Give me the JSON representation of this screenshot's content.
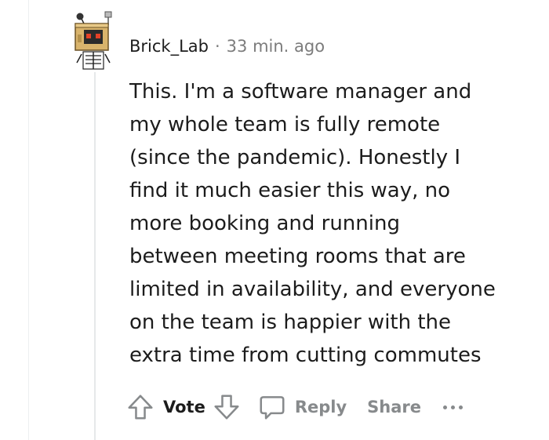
{
  "comment": {
    "username": "Brick_Lab",
    "separator": "·",
    "timestamp": "33 min. ago",
    "body": "This. I'm a software manager and\nmy whole team is fully remote\n(since the pandemic). Honestly I\nfind it much easier this way, no\nmore booking and running\nbetween meeting rooms that are\nlimited in availability, and everyone\non the team is happier with the\nextra time from cutting commutes"
  },
  "actions": {
    "vote_label": "Vote",
    "reply_label": "Reply",
    "share_label": "Share"
  },
  "icons": {
    "avatar": "robot-avatar-icon",
    "upvote": "upvote-arrow-icon",
    "downvote": "downvote-arrow-icon",
    "reply": "speech-bubble-icon",
    "more": "more-options-icon"
  },
  "colors": {
    "text": "#1c1c1c",
    "meta": "#7c7c7c",
    "action": "#878a8c",
    "thread_line": "#edeff1"
  }
}
